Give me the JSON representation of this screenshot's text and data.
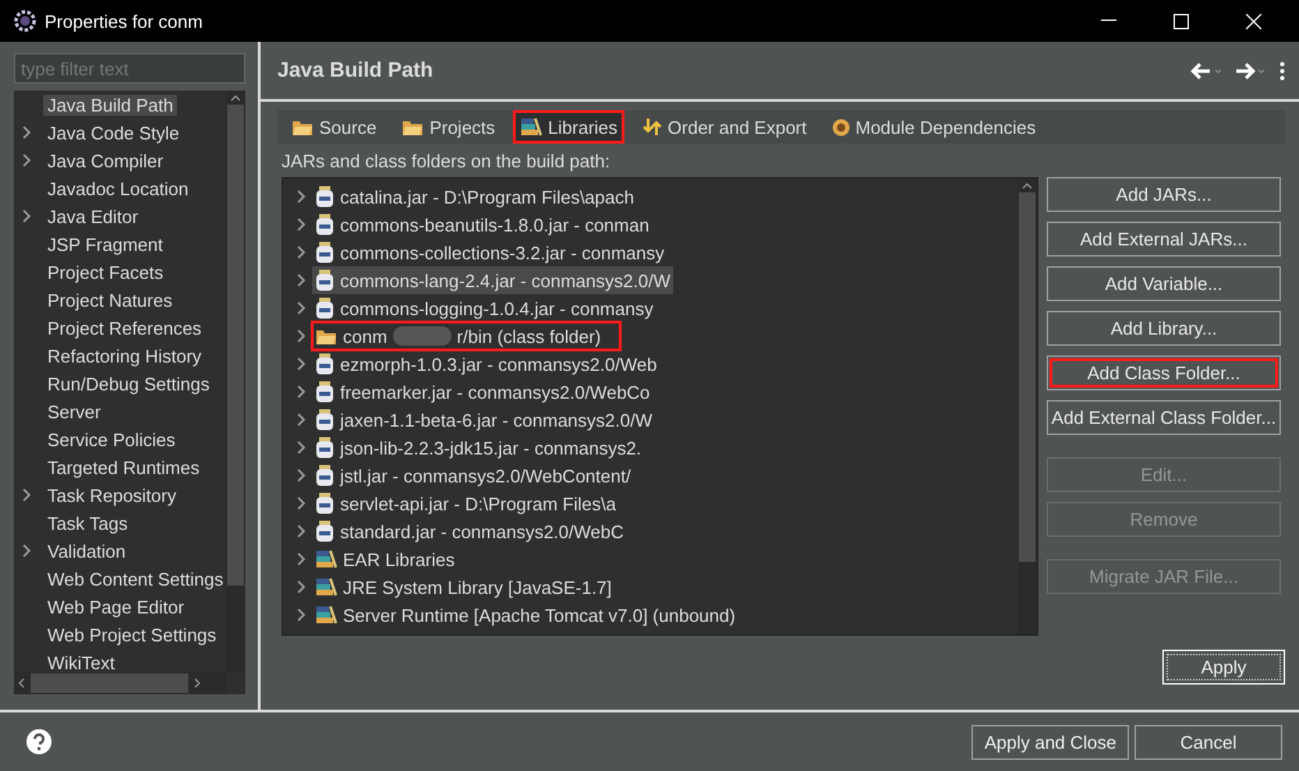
{
  "window": {
    "title": "Properties for conm"
  },
  "filter": {
    "placeholder": "type filter text"
  },
  "sidebar": {
    "items": [
      {
        "label": "Java Build Path",
        "expandable": false,
        "selected": true
      },
      {
        "label": "Java Code Style",
        "expandable": true,
        "selected": false
      },
      {
        "label": "Java Compiler",
        "expandable": true,
        "selected": false
      },
      {
        "label": "Javadoc Location",
        "expandable": false,
        "selected": false
      },
      {
        "label": "Java Editor",
        "expandable": true,
        "selected": false
      },
      {
        "label": "JSP Fragment",
        "expandable": false,
        "selected": false
      },
      {
        "label": "Project Facets",
        "expandable": false,
        "selected": false
      },
      {
        "label": "Project Natures",
        "expandable": false,
        "selected": false
      },
      {
        "label": "Project References",
        "expandable": false,
        "selected": false
      },
      {
        "label": "Refactoring History",
        "expandable": false,
        "selected": false
      },
      {
        "label": "Run/Debug Settings",
        "expandable": false,
        "selected": false
      },
      {
        "label": "Server",
        "expandable": false,
        "selected": false
      },
      {
        "label": "Service Policies",
        "expandable": false,
        "selected": false
      },
      {
        "label": "Targeted Runtimes",
        "expandable": false,
        "selected": false
      },
      {
        "label": "Task Repository",
        "expandable": true,
        "selected": false
      },
      {
        "label": "Task Tags",
        "expandable": false,
        "selected": false
      },
      {
        "label": "Validation",
        "expandable": true,
        "selected": false
      },
      {
        "label": "Web Content Settings",
        "expandable": false,
        "selected": false
      },
      {
        "label": "Web Page Editor",
        "expandable": false,
        "selected": false
      },
      {
        "label": "Web Project Settings",
        "expandable": false,
        "selected": false
      },
      {
        "label": "WikiText",
        "expandable": false,
        "selected": false
      }
    ]
  },
  "page": {
    "title": "Java Build Path"
  },
  "tabs": [
    {
      "label": "Source",
      "kind": "source",
      "selected": false,
      "highlighted": false
    },
    {
      "label": "Projects",
      "kind": "projects",
      "selected": false,
      "highlighted": false
    },
    {
      "label": "Libraries",
      "kind": "libraries",
      "selected": true,
      "highlighted": true
    },
    {
      "label": "Order and Export",
      "kind": "order",
      "selected": false,
      "highlighted": false
    },
    {
      "label": "Module Dependencies",
      "kind": "module",
      "selected": false,
      "highlighted": false
    }
  ],
  "list_label": "JARs and class folders on the build path:",
  "entries": [
    {
      "label": "catalina.jar - D:\\Program Files\\apach",
      "kind": "jar",
      "selected": false,
      "highlighted": false
    },
    {
      "label": "commons-beanutils-1.8.0.jar - conman",
      "kind": "jar",
      "selected": false,
      "highlighted": false
    },
    {
      "label": "commons-collections-3.2.jar - conmansy",
      "kind": "jar",
      "selected": false,
      "highlighted": false
    },
    {
      "label": "commons-lang-2.4.jar - conmansys2.0/W",
      "kind": "jar",
      "selected": true,
      "highlighted": false
    },
    {
      "label": "commons-logging-1.0.4.jar - conmansy",
      "kind": "jar",
      "selected": false,
      "highlighted": false
    },
    {
      "label": "conm",
      "suffix": "r/bin (class folder)",
      "kind": "folder",
      "selected": false,
      "highlighted": true
    },
    {
      "label": "ezmorph-1.0.3.jar - conmansys2.0/Web",
      "kind": "jar",
      "selected": false,
      "highlighted": false
    },
    {
      "label": "freemarker.jar - conmansys2.0/WebCo",
      "kind": "jar",
      "selected": false,
      "highlighted": false
    },
    {
      "label": "jaxen-1.1-beta-6.jar - conmansys2.0/W",
      "kind": "jar",
      "selected": false,
      "highlighted": false
    },
    {
      "label": "json-lib-2.2.3-jdk15.jar - conmansys2.",
      "kind": "jar",
      "selected": false,
      "highlighted": false
    },
    {
      "label": "jstl.jar - conmansys2.0/WebContent/",
      "kind": "jar",
      "selected": false,
      "highlighted": false
    },
    {
      "label": "servlet-api.jar - D:\\Program Files\\a",
      "kind": "jar",
      "selected": false,
      "highlighted": false
    },
    {
      "label": "standard.jar - conmansys2.0/WebC",
      "kind": "jar",
      "selected": false,
      "highlighted": false
    },
    {
      "label": "EAR Libraries",
      "kind": "library",
      "selected": false,
      "highlighted": false
    },
    {
      "label": "JRE System Library [JavaSE-1.7]",
      "kind": "library",
      "selected": false,
      "highlighted": false
    },
    {
      "label": "Server Runtime [Apache Tomcat v7.0] (unbound)",
      "kind": "library",
      "selected": false,
      "highlighted": false
    }
  ],
  "button_groups": [
    [
      {
        "label": "Add JARs...",
        "disabled": false,
        "highlighted": false
      },
      {
        "label": "Add External JARs...",
        "disabled": false,
        "highlighted": false
      },
      {
        "label": "Add Variable...",
        "disabled": false,
        "highlighted": false
      },
      {
        "label": "Add Library...",
        "disabled": false,
        "highlighted": false
      },
      {
        "label": "Add Class Folder...",
        "disabled": false,
        "highlighted": true
      },
      {
        "label": "Add External Class Folder...",
        "disabled": false,
        "highlighted": false
      }
    ],
    [
      {
        "label": "Edit...",
        "disabled": true,
        "highlighted": false
      },
      {
        "label": "Remove",
        "disabled": true,
        "highlighted": false
      }
    ],
    [
      {
        "label": "Migrate JAR File...",
        "disabled": true,
        "highlighted": false
      }
    ]
  ],
  "apply": {
    "label": "Apply"
  },
  "footer_buttons": [
    "Apply and Close",
    "Cancel"
  ]
}
